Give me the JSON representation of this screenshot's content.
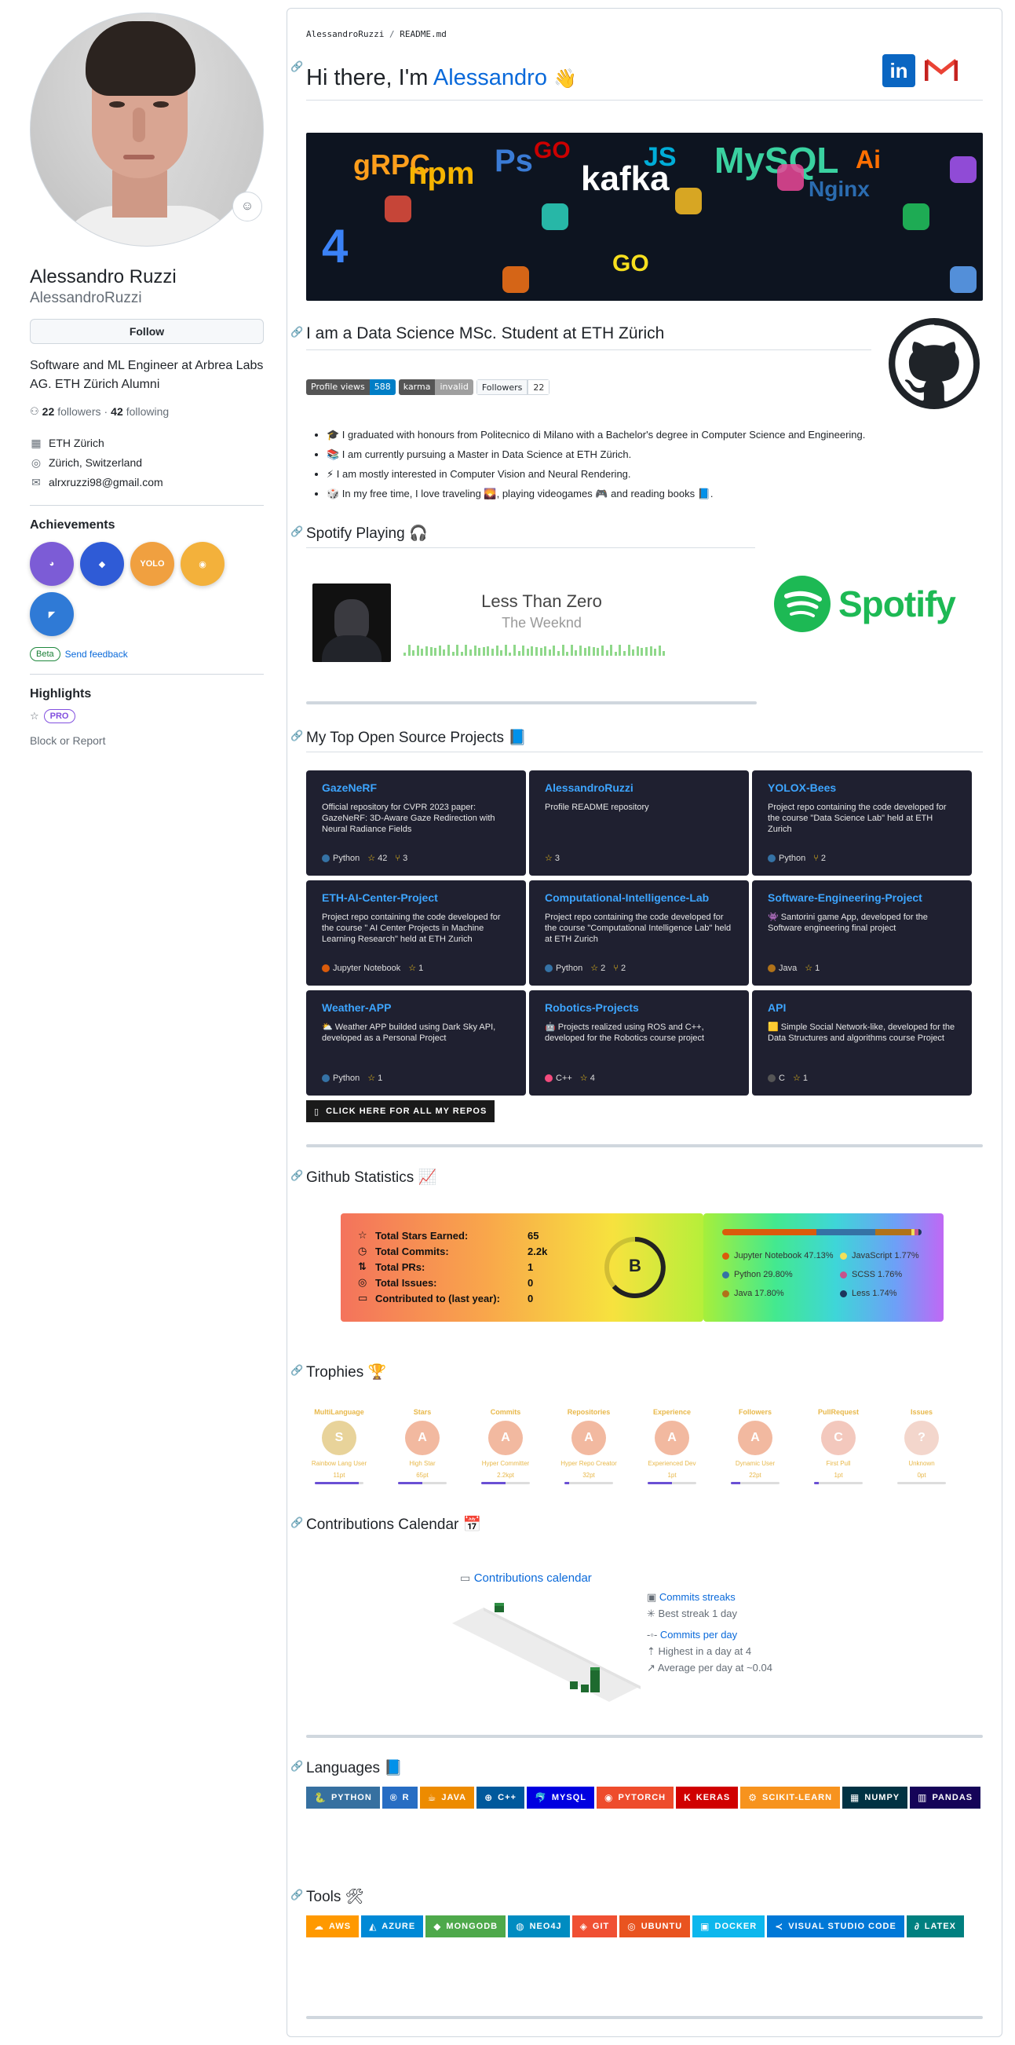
{
  "profile": {
    "full_name": "Alessandro Ruzzi",
    "username": "AlessandroRuzzi",
    "follow_label": "Follow",
    "bio": "Software and ML Engineer at Arbrea Labs AG. ETH Zürich Alumni",
    "followers_count": "22",
    "followers_label": "followers",
    "following_count": "42",
    "following_label": "following",
    "separator": "·",
    "organization": "ETH Zürich",
    "location": "Zürich, Switzerland",
    "email": "alrxruzzi98@gmail.com",
    "achievements_title": "Achievements",
    "achievements": [
      {
        "name": "achievement-badge-1",
        "color": "#7c5cd6",
        "glyph": "◕"
      },
      {
        "name": "achievement-badge-2",
        "color": "#2f5bd6",
        "glyph": "◆"
      },
      {
        "name": "achievement-badge-3",
        "color": "#f0a040",
        "glyph": "YOLO"
      },
      {
        "name": "achievement-badge-4",
        "color": "#f3b13b",
        "glyph": "◉"
      },
      {
        "name": "achievement-badge-5",
        "color": "#2f7ad6",
        "glyph": "◤"
      }
    ],
    "beta_label": "Beta",
    "send_feedback": "Send feedback",
    "highlights_title": "Highlights",
    "pro_label": "PRO",
    "block_report": "Block or Report"
  },
  "readme": {
    "path_user": "AlessandroRuzzi",
    "path_sep": "/",
    "path_file": "README.md",
    "greeting": "Hi there, I'm ",
    "greeting_name": "Alessandro",
    "wave": "👋",
    "banner_words": [
      "gRPC",
      "npm",
      "Ps",
      "GO",
      "kafka",
      "JS",
      "MySQL",
      "Nginx",
      "Ai",
      "4",
      "GO"
    ],
    "subtitle": "I am a Data Science MSc. Student at ETH Zürich",
    "badges": [
      {
        "left": "Profile views",
        "right": "588",
        "color": "#007ec6"
      },
      {
        "left": "karma",
        "right": "invalid",
        "color": "#9f9f9f"
      },
      {
        "left": "Followers",
        "right": "22",
        "color": "#ffffff"
      }
    ],
    "bullets": [
      "🎓 I graduated with honours from Politecnico di Milano with a Bachelor's degree in Computer Science and Engineering.",
      "📚 I am currently pursuing a Master in Data Science at ETH Zürich.",
      "⚡ I am mostly interested in Computer Vision and Neural Rendering.",
      "🎲 In my free time, I love traveling 🌄, playing videogames 🎮 and reading books 📘."
    ],
    "spotify_title": "Spotify Playing",
    "spotify_icon": "🎧",
    "song": "Less Than Zero",
    "artist": "The Weeknd",
    "spotify_brand": "Spotify",
    "projects_title": "My Top Open Source Projects",
    "projects_icon": "📘",
    "projects": [
      {
        "name": "GazeNeRF",
        "desc": "Official repository for CVPR 2023 paper: GazeNeRF: 3D-Aware Gaze Redirection with Neural Radiance Fields",
        "lang": "Python",
        "lang_color": "#3572A5",
        "stars": "42",
        "forks": "3"
      },
      {
        "name": "AlessandroRuzzi",
        "desc": "Profile README repository",
        "lang": "",
        "lang_color": "",
        "stars": "3",
        "forks": ""
      },
      {
        "name": "YOLOX-Bees",
        "desc": "Project repo containing the code developed for the course \"Data Science Lab\" held at ETH Zurich",
        "lang": "Python",
        "lang_color": "#3572A5",
        "stars": "",
        "forks": "2"
      },
      {
        "name": "ETH-AI-Center-Project",
        "desc": "Project repo containing the code developed for the course \" AI Center Projects in Machine Learning Research\" held at ETH Zurich",
        "lang": "Jupyter Notebook",
        "lang_color": "#DA5B0B",
        "stars": "1",
        "forks": ""
      },
      {
        "name": "Computational-Intelligence-Lab",
        "desc": "Project repo containing the code developed for the course \"Computational Intelligence Lab\" held at ETH Zurich",
        "lang": "Python",
        "lang_color": "#3572A5",
        "stars": "2",
        "forks": "2"
      },
      {
        "name": "Software-Engineering-Project",
        "desc": "👾 Santorini game App, developed for the Software engineering final project",
        "lang": "Java",
        "lang_color": "#b07219",
        "stars": "1",
        "forks": ""
      },
      {
        "name": "Weather-APP",
        "desc": "⛅ Weather APP builded using Dark Sky API, developed as a Personal Project",
        "lang": "Python",
        "lang_color": "#3572A5",
        "stars": "1",
        "forks": ""
      },
      {
        "name": "Robotics-Projects",
        "desc": "🤖 Projects realized using ROS and C++, developed for the Robotics course project",
        "lang": "C++",
        "lang_color": "#f34b7d",
        "stars": "4",
        "forks": ""
      },
      {
        "name": "API",
        "desc": "🟨 Simple Social Network-like, developed for the Data Structures and algorithms course Project",
        "lang": "C",
        "lang_color": "#555555",
        "stars": "1",
        "forks": ""
      }
    ],
    "repos_button": "CLICK HERE FOR ALL MY REPOS",
    "stats_title": "Github Statistics",
    "stats_icon": "📈",
    "stats": [
      {
        "icon": "☆",
        "label": "Total Stars Earned:",
        "value": "65"
      },
      {
        "icon": "◷",
        "label": "Total Commits:",
        "value": "2.2k"
      },
      {
        "icon": "⇅",
        "label": "Total PRs:",
        "value": "1"
      },
      {
        "icon": "◎",
        "label": "Total Issues:",
        "value": "0"
      },
      {
        "icon": "▭",
        "label": "Contributed to (last year):",
        "value": "0"
      }
    ],
    "rank": "B",
    "langs_used": [
      {
        "name": "Jupyter Notebook 47.13%",
        "color": "#DA5B0B",
        "pct": 47.13
      },
      {
        "name": "JavaScript 1.77%",
        "color": "#f1e05a",
        "pct": 1.77
      },
      {
        "name": "Python 29.80%",
        "color": "#3572A5",
        "pct": 29.8
      },
      {
        "name": "SCSS 1.76%",
        "color": "#c6538c",
        "pct": 1.76
      },
      {
        "name": "Java 17.80%",
        "color": "#b07219",
        "pct": 17.8
      },
      {
        "name": "Less 1.74%",
        "color": "#1d365d",
        "pct": 1.74
      }
    ],
    "trophies_title": "Trophies",
    "trophies_icon": "🏆",
    "trophies": [
      {
        "title": "MultiLanguage",
        "rank": "S",
        "name": "Rainbow Lang User",
        "value": "11pt",
        "fill": 0.9,
        "color": "#e8d39a"
      },
      {
        "title": "Stars",
        "rank": "A",
        "name": "High Star",
        "value": "65pt",
        "fill": 0.5,
        "color": "#f2b9a0"
      },
      {
        "title": "Commits",
        "rank": "A",
        "name": "Hyper Committer",
        "value": "2.2kpt",
        "fill": 0.5,
        "color": "#f2b9a0"
      },
      {
        "title": "Repositories",
        "rank": "A",
        "name": "Hyper Repo Creator",
        "value": "32pt",
        "fill": 0.1,
        "color": "#f2b9a0"
      },
      {
        "title": "Experience",
        "rank": "A",
        "name": "Experienced Dev",
        "value": "1pt",
        "fill": 0.5,
        "color": "#f2b9a0"
      },
      {
        "title": "Followers",
        "rank": "A",
        "name": "Dynamic User",
        "value": "22pt",
        "fill": 0.2,
        "color": "#f2b9a0"
      },
      {
        "title": "PullRequest",
        "rank": "C",
        "name": "First Pull",
        "value": "1pt",
        "fill": 0.1,
        "color": "#f3c8bd"
      },
      {
        "title": "Issues",
        "rank": "?",
        "name": "Unknown",
        "value": "0pt",
        "fill": 0.0,
        "color": "#f3d6cc"
      }
    ],
    "calendar_title": "Contributions Calendar",
    "calendar_icon": "📅",
    "calendar_link": "Contributions calendar",
    "commits_streaks": "Commits streaks",
    "best_streak": "Best streak 1 day",
    "commits_per_day": "Commits per day",
    "highest_day": "Highest in a day at 4",
    "average_day": "Average per day at ~0.04",
    "languages_title": "Languages",
    "languages_icon": "📘",
    "languages": [
      {
        "label": "PYTHON",
        "color": "#3670A0",
        "icon": "🐍"
      },
      {
        "label": "R",
        "color": "#276DC3",
        "icon": "®"
      },
      {
        "label": "JAVA",
        "color": "#ED8B00",
        "icon": "☕"
      },
      {
        "label": "C++",
        "color": "#00599C",
        "icon": "⊕"
      },
      {
        "label": "MYSQL",
        "color": "#0000e0",
        "icon": "🐬"
      },
      {
        "label": "PYTORCH",
        "color": "#EE4C2C",
        "icon": "◉"
      },
      {
        "label": "KERAS",
        "color": "#D00000",
        "icon": "K"
      },
      {
        "label": "SCIKIT-LEARN",
        "color": "#F7931E",
        "icon": "⚙"
      },
      {
        "label": "NUMPY",
        "color": "#013243",
        "icon": "▦"
      },
      {
        "label": "PANDAS",
        "color": "#150458",
        "icon": "▥"
      }
    ],
    "tools_title": "Tools",
    "tools_icon": "🛠",
    "tools": [
      {
        "label": "AWS",
        "color": "#FF9900",
        "icon": "☁"
      },
      {
        "label": "AZURE",
        "color": "#0089d6",
        "icon": "◭"
      },
      {
        "label": "MONGODB",
        "color": "#4ea94b",
        "icon": "◆"
      },
      {
        "label": "NEO4J",
        "color": "#008CC1",
        "icon": "◍"
      },
      {
        "label": "GIT",
        "color": "#F05033",
        "icon": "◈"
      },
      {
        "label": "UBUNTU",
        "color": "#E95420",
        "icon": "◎"
      },
      {
        "label": "DOCKER",
        "color": "#0db7ed",
        "icon": "▣"
      },
      {
        "label": "VISUAL STUDIO CODE",
        "color": "#0078d7",
        "icon": "≺"
      },
      {
        "label": "LATEX",
        "color": "#008080",
        "icon": "∂"
      }
    ]
  }
}
